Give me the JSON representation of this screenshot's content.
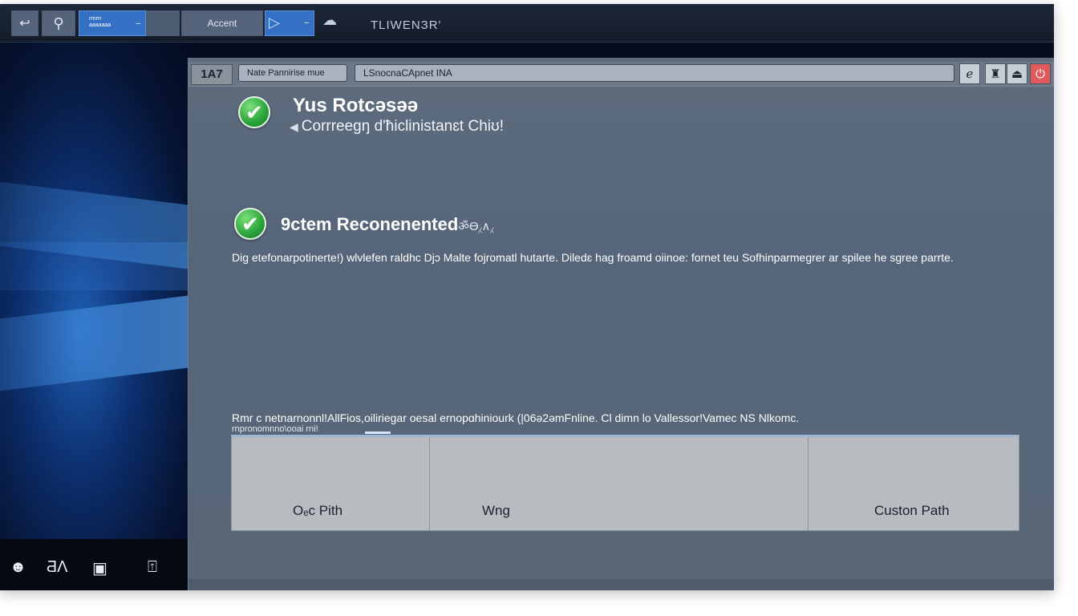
{
  "taskbar": {
    "back_glyph": "↩",
    "pin_glyph": "⚲",
    "app_label": "rrnrrr\naaaaaaa",
    "app_dash": "–",
    "accent_label": "Accent",
    "play_glyph": "▷",
    "play_dash": "–",
    "weather_glyph": "☁",
    "title": "TLIWENЗR'"
  },
  "tray": {
    "icon1": "☻",
    "icon2": "ƋΛ",
    "icon3": "▣",
    "icon4": "⍐"
  },
  "window": {
    "addr_icon_label": "1A7",
    "addr_field1": "Nate Pannirise mue",
    "addr_field2": "LSnocnaCApnet INA",
    "btn_refresh": "ℯ",
    "btn_mid": "♜",
    "btn_min": "⏏",
    "btn_close": "⏻",
    "check_glyph": "✔",
    "heading1": "Yus Rotcǝsǝǝ",
    "heading1_sub_arrow": "◀",
    "heading1_sub": "Corrreegŋ d'ħiclinistanɛt Chiʊ!",
    "heading2": "9ctem Reconenented",
    "heading2_tail": "ॐƟ⁁∧⁁",
    "description": "Dig etefonarpotinerte!) wlvlefen raldhc Djɔ Malte fojromatl hutarte. Diledɛ hag froamd oiinoe: fornet teu Sofhinparmegrer ar spilee he sgree parrte.",
    "description2": "Rmr c netnarnonnl!AllFios,oiliriegar oesal ernopɑhiniourk (|06ǝ2ǝmFnline. Cl dimn lo Vallessor!Vamec NS Nlkomc.",
    "description3": "rnpronomnno\\ooai rni!",
    "options": [
      {
        "label": "Oₑc Pith"
      },
      {
        "label": "Wng"
      },
      {
        "label": "Custon Path"
      }
    ]
  }
}
